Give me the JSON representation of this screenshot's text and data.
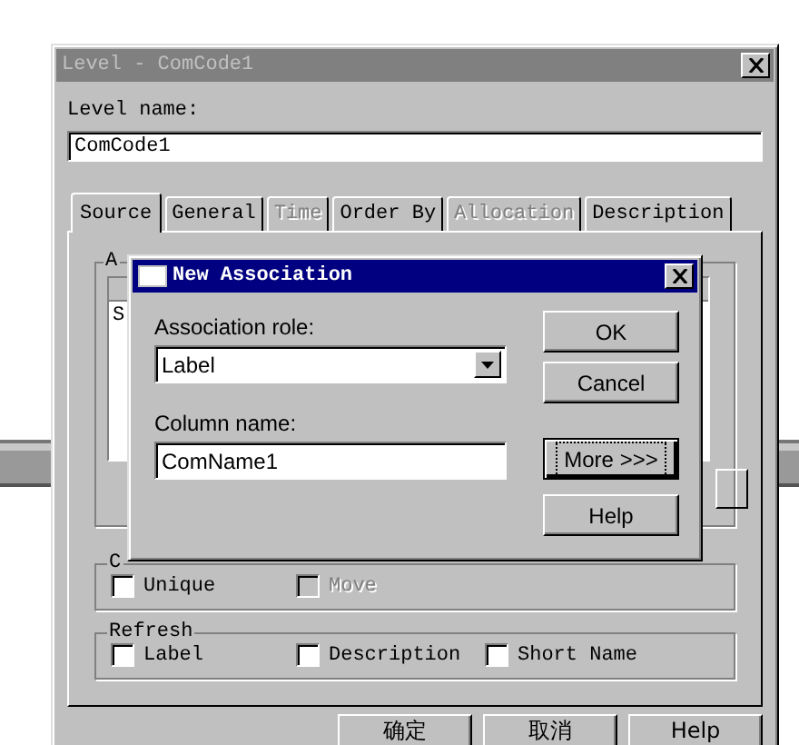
{
  "window": {
    "title": "Level - ComCode1"
  },
  "level_name": {
    "label": "Level name:",
    "value": "ComCode1"
  },
  "tabs": [
    {
      "label": "Source",
      "selected": true,
      "disabled": false
    },
    {
      "label": "General",
      "selected": false,
      "disabled": false
    },
    {
      "label": "Time",
      "selected": false,
      "disabled": true
    },
    {
      "label": "Order By",
      "selected": false,
      "disabled": false
    },
    {
      "label": "Allocation",
      "selected": false,
      "disabled": true
    },
    {
      "label": "Description",
      "selected": false,
      "disabled": false
    }
  ],
  "association_group": {
    "label": "A",
    "list_item": "S"
  },
  "category_group": {
    "label": "C",
    "checkboxes": [
      {
        "label": "Unique",
        "checked": false,
        "disabled": false
      },
      {
        "label": "Move",
        "checked": false,
        "disabled": true
      }
    ]
  },
  "refresh_group": {
    "label": "Refresh",
    "checkboxes": [
      {
        "label": "Label",
        "checked": false,
        "disabled": false
      },
      {
        "label": "Description",
        "checked": false,
        "disabled": false
      },
      {
        "label": "Short Name",
        "checked": false,
        "disabled": false
      }
    ]
  },
  "buttons": [
    "确定",
    "取消",
    "Help"
  ],
  "dialog": {
    "title": "New Association",
    "role": {
      "label": "Association role:",
      "value": "Label"
    },
    "column": {
      "label": "Column name:",
      "value": "ComName1"
    },
    "buttons": [
      {
        "label": "OK",
        "focused": false
      },
      {
        "label": "Cancel",
        "focused": false
      },
      {
        "label": "More >>>",
        "focused": true
      },
      {
        "label": "Help",
        "focused": false
      }
    ]
  }
}
